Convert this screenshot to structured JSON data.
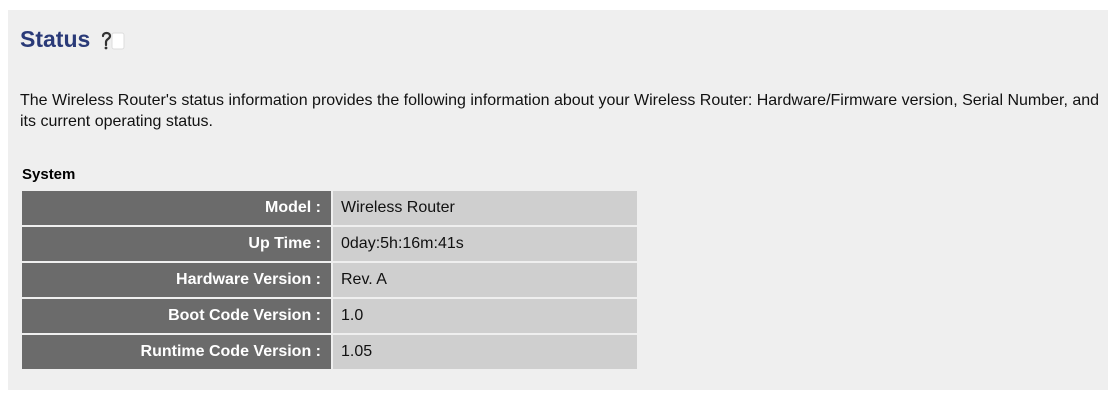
{
  "page": {
    "title": "Status",
    "help_icon": "help-icon",
    "description": "The Wireless Router's status information provides the following information about your Wireless Router: Hardware/Firmware version, Serial Number, and its current operating status."
  },
  "system": {
    "label": "System",
    "rows": [
      {
        "key": "Model :",
        "value": "Wireless Router"
      },
      {
        "key": "Up Time :",
        "value": "0day:5h:16m:41s"
      },
      {
        "key": "Hardware Version :",
        "value": "Rev. A"
      },
      {
        "key": "Boot Code Version :",
        "value": "1.0"
      },
      {
        "key": "Runtime Code Version :",
        "value": "1.05"
      }
    ]
  },
  "colors": {
    "title": "#2a3a78",
    "panel_bg": "#efefef",
    "key_bg": "#6b6b6b",
    "value_bg": "#cfcfcf"
  }
}
